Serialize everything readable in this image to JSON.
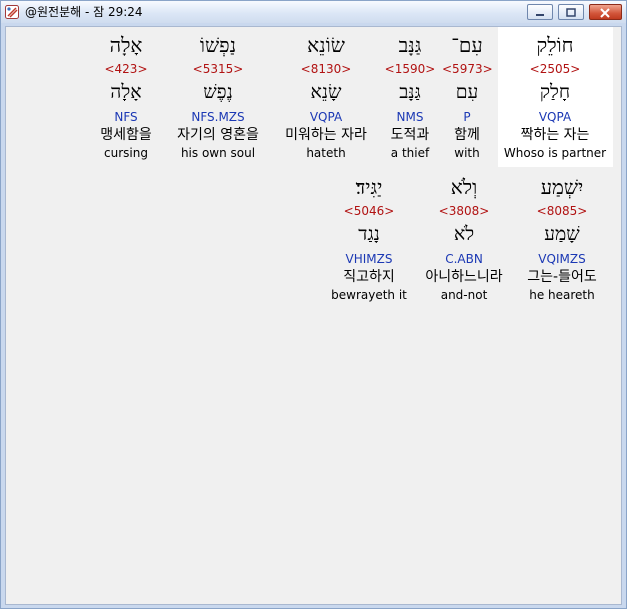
{
  "window": {
    "title": "@원전분해 - 잠 29:24",
    "minimize_label": "",
    "maximize_label": "",
    "close_label": ""
  },
  "colors": {
    "hebrew": "#000000",
    "strong_number": "#b11212",
    "morphology": "#1b38b4",
    "highlight_bg": "#ffffff"
  },
  "rows": [
    {
      "words": [
        {
          "hebrew": "חוֹלֵק",
          "strong": "<2505>",
          "lemma": "חָלַק",
          "morph": "VQPA",
          "korean": "짝하는 자는",
          "english": "Whoso is partner"
        },
        {
          "hebrew": "עִם־",
          "strong": "<5973>",
          "lemma": "עִם",
          "morph": "P",
          "korean": "함께",
          "english": "with"
        },
        {
          "hebrew": "גַּנָּב",
          "strong": "<1590>",
          "lemma": "גַּנָּב",
          "morph": "NMS",
          "korean": "도적과",
          "english": "a thief"
        },
        {
          "hebrew": "שׂוֹנֵא",
          "strong": "<8130>",
          "lemma": "שָׂנֵא",
          "morph": "VQPA",
          "korean": "미워하는 자라",
          "english": "hateth"
        },
        {
          "hebrew": "נַפְשׁוֹ",
          "strong": "<5315>",
          "lemma": "נֶפֶשׁ",
          "morph": "NFS.MZS",
          "korean": "자기의 영혼을",
          "english": "his own soul"
        },
        {
          "hebrew": "אָלָה",
          "strong": "<423>",
          "lemma": "אָלָה",
          "morph": "NFS",
          "korean": "맹세함을",
          "english": "cursing"
        }
      ]
    },
    {
      "words": [
        {
          "hebrew": "יִשְׁמַע",
          "strong": "<8085>",
          "lemma": "שָׁמַע",
          "morph": "VQIMZS",
          "korean": "그는-들어도",
          "english": "he heareth"
        },
        {
          "hebrew": "וְלֹא",
          "strong": "<3808>",
          "lemma": "לֹא",
          "morph": "C.ABN",
          "korean": "아니하느니라",
          "english": "and-not"
        },
        {
          "hebrew": "יַגִּיד׃",
          "strong": "<5046>",
          "lemma": "נָגַד",
          "morph": "VHIMZS",
          "korean": "직고하지",
          "english": "bewrayeth it"
        }
      ]
    }
  ]
}
